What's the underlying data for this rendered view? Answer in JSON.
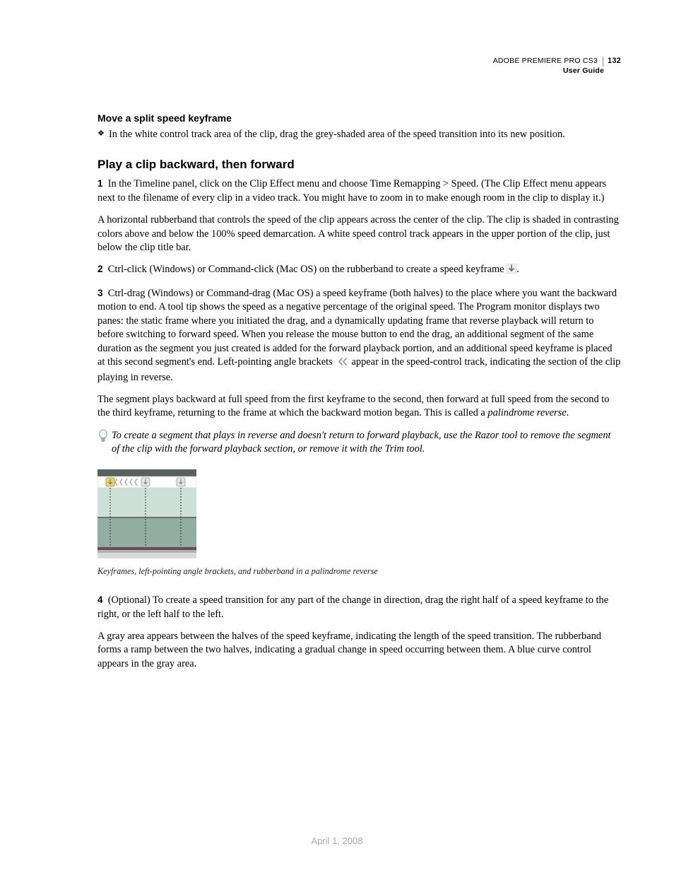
{
  "header": {
    "product": "ADOBE PREMIERE PRO CS3",
    "subtitle": "User Guide",
    "page": "132"
  },
  "section1": {
    "title": "Move a split speed keyframe",
    "bullet": "In the white control track area of the clip, drag the grey-shaded area of the speed transition into its new position."
  },
  "section2": {
    "title": "Play a clip backward, then forward",
    "step1_num": "1",
    "step1": "In the Timeline panel, click on the Clip Effect menu and choose Time Remapping > Speed. (The Clip Effect menu appears next to the filename of every clip in a video track. You might have to zoom in to make enough room in the clip to display it.)",
    "para1": "A horizontal rubberband that controls the speed of the clip appears across the center of the clip. The clip is shaded in contrasting colors above and below the 100% speed demarcation. A white speed control track appears in the upper portion of the clip, just below the clip title bar.",
    "step2_num": "2",
    "step2_a": "Ctrl-click (Windows) or Command-click (Mac OS) on the rubberband to create a speed keyframe ",
    "step2_b": ".",
    "step3_num": "3",
    "step3_a": "Ctrl-drag (Windows) or Command-drag (Mac OS) a speed keyframe (both halves) to the place where you want the backward motion to end. A tool tip shows the speed as a negative percentage of the original speed. The Program monitor displays two panes: the static frame where you initiated the drag, and a dynamically updating frame that reverse playback will return to before switching to forward speed. When you release the mouse button to end the drag, an additional segment of the same duration as the segment you just created is added for the forward playback portion, and an additional speed keyframe is placed at this second segment's end. Left-pointing angle brackets ",
    "step3_b": " appear in the speed-control track, indicating the section of the clip playing in reverse.",
    "para2_a": "The segment plays backward at full speed from the first keyframe to the second, then forward at full speed from the second to the third keyframe, returning to the frame at which the backward motion began. This is called a ",
    "para2_b": "palindrome reverse",
    "para2_c": ".",
    "tip": "To create a segment that plays in reverse and doesn't return to forward playback, use the Razor tool to remove the segment of the clip with the forward playback section, or remove it with the Trim tool.",
    "caption": "Keyframes, left-pointing angle brackets, and rubberband in a palindrome reverse",
    "step4_num": "4",
    "step4": "(Optional) To create a speed transition for any part of the change in direction, drag the right half of a speed keyframe to the right, or the left half to the left.",
    "para3": "A gray area appears between the halves of the speed keyframe, indicating the length of the speed transition. The rubberband forms a ramp between the two halves, indicating a gradual change in speed occurring between them. A blue curve control appears in the gray area."
  },
  "footer": {
    "date": "April 1, 2008"
  }
}
